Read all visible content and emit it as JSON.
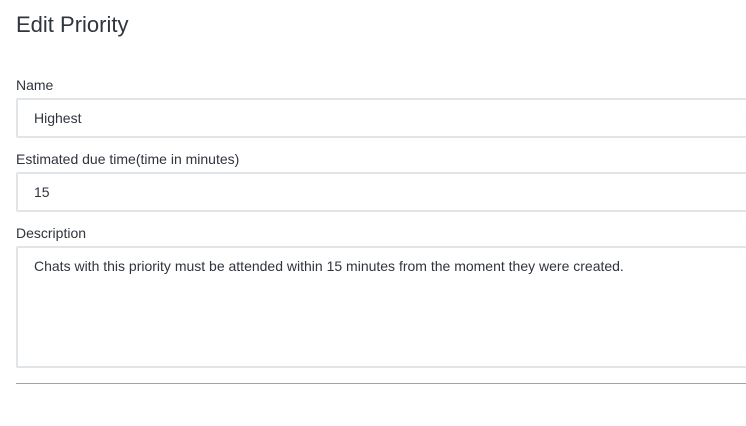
{
  "page": {
    "title": "Edit Priority"
  },
  "form": {
    "name": {
      "label": "Name",
      "value": "Highest"
    },
    "due_time": {
      "label": "Estimated due time(time in minutes)",
      "value": "15"
    },
    "description": {
      "label": "Description",
      "value": "Chats with this priority must be attended within 15 minutes from the moment they were created."
    }
  },
  "colors": {
    "text": "#2f343d",
    "input_border": "#e1e5e8",
    "divider": "#9ea2a8"
  }
}
